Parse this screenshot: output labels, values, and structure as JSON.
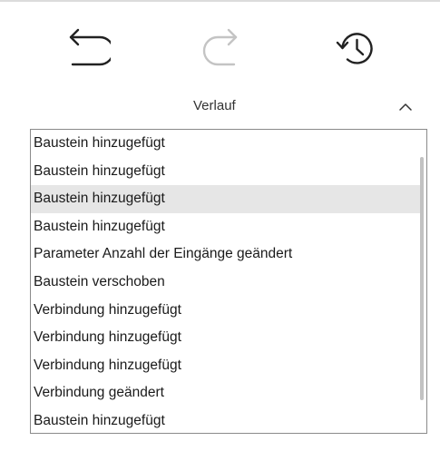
{
  "toolbar": {
    "undo_icon": "undo-arrow-icon",
    "redo_icon": "redo-arrow-icon",
    "history_icon": "history-clock-icon",
    "redo_enabled": false
  },
  "panel": {
    "title": "Verlauf",
    "collapse_icon": "chevron-up-icon"
  },
  "history_items": [
    "Baustein hinzugefügt",
    "Baustein hinzugefügt",
    "Baustein hinzugefügt",
    "Baustein hinzugefügt",
    "Parameter Anzahl der Eingänge geändert",
    "Baustein verschoben",
    "Verbindung hinzugefügt",
    "Verbindung hinzugefügt",
    "Verbindung hinzugefügt",
    "Verbindung geändert",
    "Baustein hinzugefügt"
  ],
  "hovered_index": 2,
  "colors": {
    "icon_active": "#222222",
    "icon_disabled": "#c4c4c4",
    "hover_bg": "#e6e6e6",
    "border": "#8a8a8a"
  }
}
